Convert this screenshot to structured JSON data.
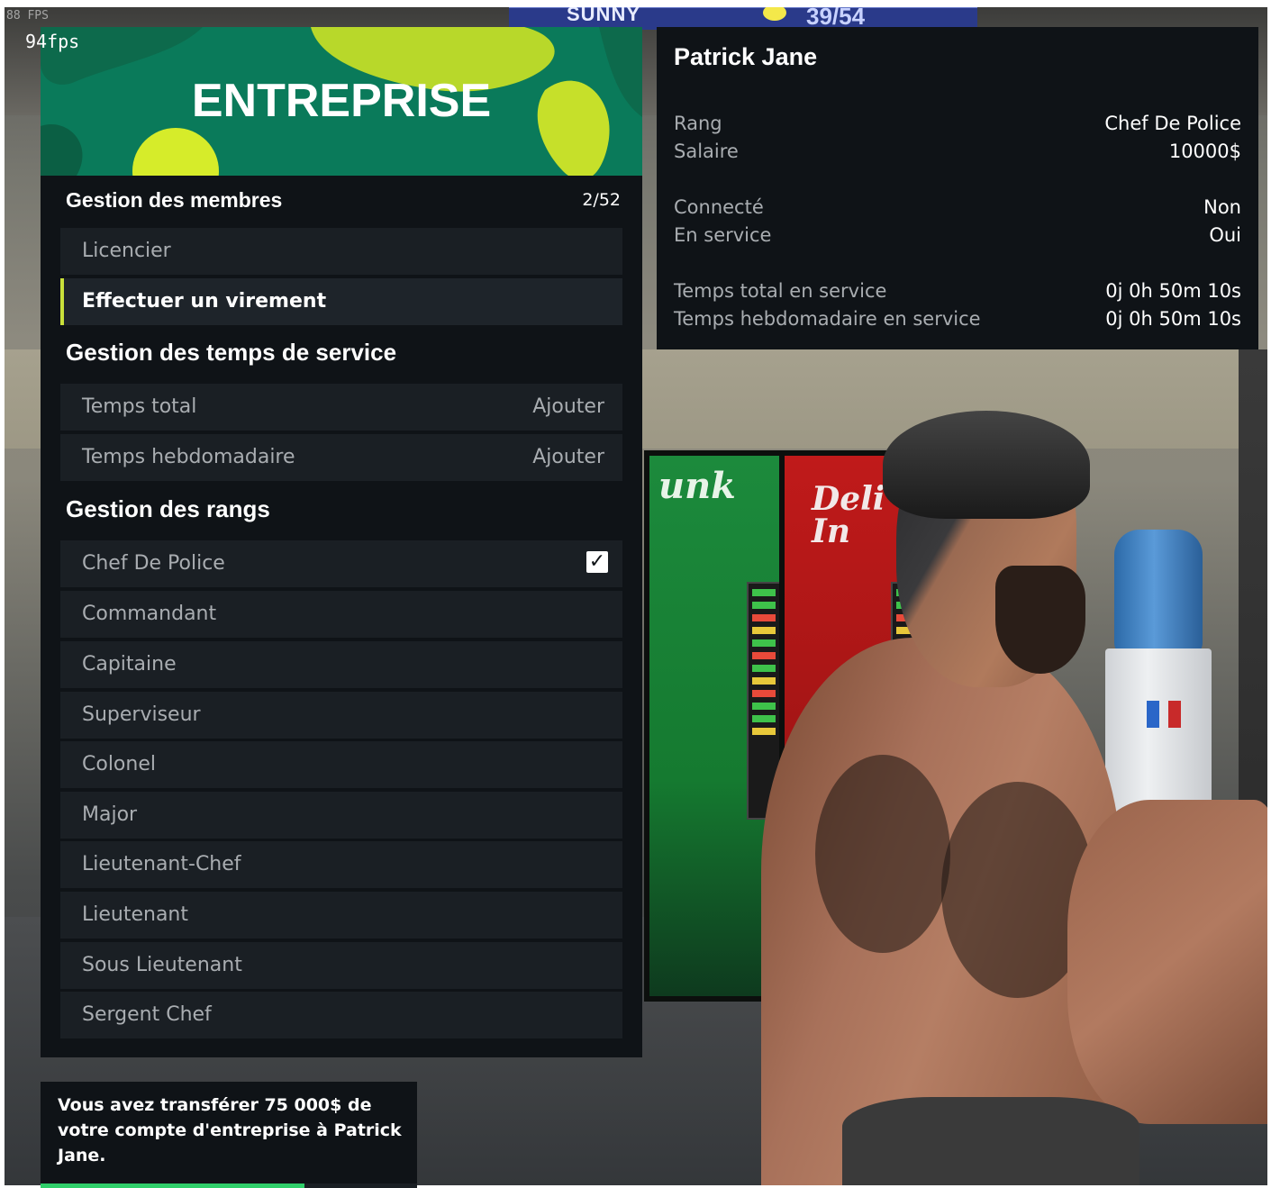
{
  "overlay": {
    "fps_top": "88 FPS",
    "fps_main": "94fps"
  },
  "scene": {
    "sign_left": "SUNNY",
    "sign_right": "39/54",
    "machine_left_logo": "unk",
    "machine_right_logo": "Deli In"
  },
  "menu": {
    "title": "ENTREPRISE",
    "members_section": {
      "label": "Gestion des membres",
      "count": "2/52",
      "items": [
        {
          "label": "Licencier"
        },
        {
          "label": "Effectuer un virement",
          "active": true
        }
      ]
    },
    "time_section": {
      "label": "Gestion des temps de service",
      "items": [
        {
          "label": "Temps total",
          "action": "Ajouter"
        },
        {
          "label": "Temps hebdomadaire",
          "action": "Ajouter"
        }
      ]
    },
    "ranks_section": {
      "label": "Gestion des rangs",
      "items": [
        {
          "label": "Chef De Police",
          "checked": true
        },
        {
          "label": "Commandant"
        },
        {
          "label": "Capitaine"
        },
        {
          "label": "Superviseur"
        },
        {
          "label": "Colonel"
        },
        {
          "label": "Major"
        },
        {
          "label": "Lieutenant-Chef"
        },
        {
          "label": "Lieutenant"
        },
        {
          "label": "Sous Lieutenant"
        },
        {
          "label": "Sergent Chef"
        }
      ]
    }
  },
  "info": {
    "name": "Patrick Jane",
    "rows": [
      {
        "key": "Rang",
        "value": "Chef De Police"
      },
      {
        "key": "Salaire",
        "value": "10000$"
      },
      {
        "key": "Connecté",
        "value": "Non"
      },
      {
        "key": "En service",
        "value": "Oui"
      },
      {
        "key": "Temps total en service",
        "value": "0j 0h 50m 10s"
      },
      {
        "key": "Temps hebdomadaire en service",
        "value": "0j 0h 50m 10s"
      }
    ]
  },
  "notification": {
    "message": "Vous avez transférer 75 000$ de votre compte d'entreprise à Patrick Jane.",
    "progress": 0.7
  },
  "colors": {
    "accent": "#c9e03a",
    "panel": "#0f1317",
    "row": "#1a1f24",
    "header_green": "#0a7a5a",
    "progress": "#2fcf6a"
  }
}
